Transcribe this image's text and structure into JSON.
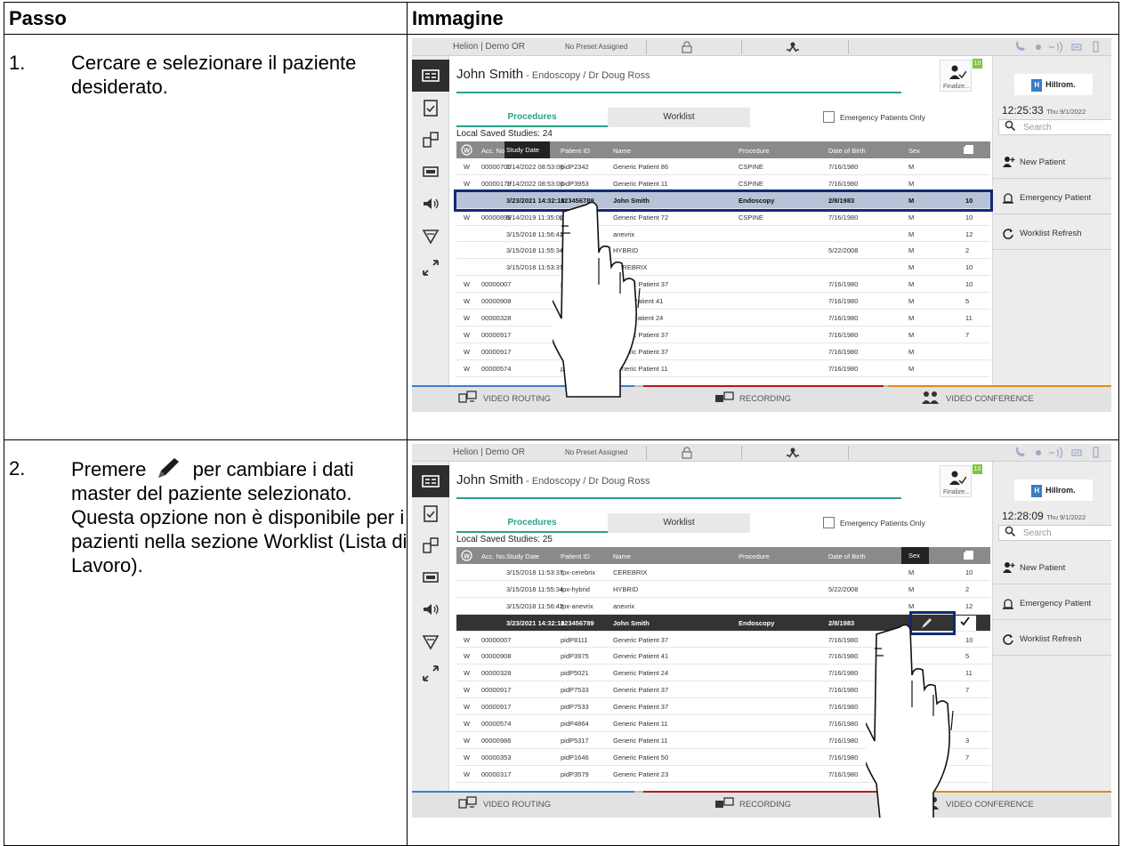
{
  "table": {
    "col_step": "Passo",
    "col_image": "Immagine"
  },
  "steps": [
    {
      "num": "1.",
      "text_before": "Cercare e selezionare il paziente desiderato.",
      "pencil": false,
      "text_after": ""
    },
    {
      "num": "2.",
      "text_before": "Premere",
      "pencil": true,
      "text_after": "per cambiare i dati master del paziente selezionato. Questa opzione non è disponibile per i pazienti nella sezione Worklist (Lista di Lavoro)."
    }
  ],
  "screens": [
    {
      "topbar": {
        "room": "Helion | Demo OR",
        "preset": "No Preset Assigned"
      },
      "patient": {
        "name": "John Smith",
        "detail": " - Endoscopy / Dr Doug Ross"
      },
      "finalize": "Finalize...",
      "finalize_badge": "10",
      "tabs": {
        "procedures": "Procedures",
        "worklist": "Worklist"
      },
      "emergency_only": "Emergency Patients Only",
      "local_saved": "Local Saved Studies: 24",
      "logo": "Hillrom.",
      "clock": {
        "time": "12:25:33",
        "date": "Thu 9/1/2022"
      },
      "search_placeholder": "Search",
      "buttons": [
        "New Patient",
        "Emergency Patient",
        "Worklist Refresh"
      ],
      "columns": [
        "Acc. No.",
        "Study Date",
        "Patient ID",
        "Name",
        "Procedure",
        "Date of Birth",
        "Sex"
      ],
      "rows": [
        {
          "w": "W",
          "acc": "00000706",
          "date": "1/14/2022 08:53:00",
          "pid": "pidP2342",
          "name": "Generic Patient 86",
          "proc": "CSPINE",
          "dob": "7/16/1980",
          "sex": "M",
          "n": "",
          "style": ""
        },
        {
          "w": "W",
          "acc": "00000178",
          "date": "1/14/2022 08:53:00",
          "pid": "pidP3953",
          "name": "Generic Patient 11",
          "proc": "CSPINE",
          "dob": "7/16/1980",
          "sex": "M",
          "n": "",
          "style": ""
        },
        {
          "w": "",
          "acc": "",
          "date": "3/23/2021 14:32:10",
          "pid": "123456789",
          "name": "John Smith",
          "proc": "Endoscopy",
          "dob": "2/8/1983",
          "sex": "M",
          "n": "10",
          "style": "hl"
        },
        {
          "w": "W",
          "acc": "00000896",
          "date": "5/14/2019 11:35:00",
          "pid": "pidP6920",
          "name": "Generic Patient 72",
          "proc": "CSPINE",
          "dob": "7/16/1980",
          "sex": "M",
          "n": "10",
          "style": ""
        },
        {
          "w": "",
          "acc": "",
          "date": "3/15/2018 11:56:42",
          "pid": "tpx-anevrix",
          "name": "anevrix",
          "proc": "",
          "dob": "",
          "sex": "M",
          "n": "12",
          "style": ""
        },
        {
          "w": "",
          "acc": "",
          "date": "3/15/2018 11:55:34",
          "pid": "tpx-hybrid",
          "name": "HYBRID",
          "proc": "",
          "dob": "5/22/2008",
          "sex": "M",
          "n": "2",
          "style": ""
        },
        {
          "w": "",
          "acc": "",
          "date": "3/15/2018 11:53:37",
          "pid": "tpx-ce",
          "name": "CEREBRIX",
          "proc": "",
          "dob": "",
          "sex": "M",
          "n": "10",
          "style": ""
        },
        {
          "w": "W",
          "acc": "00000007",
          "date": "",
          "pid": "p",
          "name": "Generic Patient 37",
          "proc": "",
          "dob": "7/16/1980",
          "sex": "M",
          "n": "10",
          "style": ""
        },
        {
          "w": "W",
          "acc": "00000908",
          "date": "",
          "pid": "",
          "name": "eneric Patient 41",
          "proc": "",
          "dob": "7/16/1980",
          "sex": "M",
          "n": "5",
          "style": ""
        },
        {
          "w": "W",
          "acc": "00000328",
          "date": "",
          "pid": "",
          "name": "eneric Patient 24",
          "proc": "",
          "dob": "7/16/1980",
          "sex": "M",
          "n": "11",
          "style": ""
        },
        {
          "w": "W",
          "acc": "00000917",
          "date": "",
          "pid": "p",
          "name": "Generic Patient 37",
          "proc": "",
          "dob": "7/16/1980",
          "sex": "M",
          "n": "7",
          "style": ""
        },
        {
          "w": "W",
          "acc": "00000917",
          "date": "",
          "pid": "pid",
          "name": "Generic Patient 37",
          "proc": "",
          "dob": "7/16/1980",
          "sex": "M",
          "n": "",
          "style": ""
        },
        {
          "w": "W",
          "acc": "00000574",
          "date": "",
          "pid": "pidl",
          "name": "Generic Patient 11",
          "proc": "",
          "dob": "7/16/1980",
          "sex": "M",
          "n": "",
          "style": ""
        }
      ],
      "bottom": [
        "VIDEO ROUTING",
        "RECORDING",
        "VIDEO CONFERENCE"
      ],
      "highlight_row": 2,
      "hand_mode": "row"
    },
    {
      "topbar": {
        "room": "Helion | Demo OR",
        "preset": "No Preset Assigned"
      },
      "patient": {
        "name": "John Smith",
        "detail": " - Endoscopy / Dr Doug Ross"
      },
      "finalize": "Finalize...",
      "finalize_badge": "10",
      "tabs": {
        "procedures": "Procedures",
        "worklist": "Worklist"
      },
      "emergency_only": "Emergency Patients Only",
      "local_saved": "Local Saved Studies: 25",
      "logo": "Hillrom.",
      "clock": {
        "time": "12:28:09",
        "date": "Thu 9/1/2022"
      },
      "search_placeholder": "Search",
      "buttons": [
        "New Patient",
        "Emergency Patient",
        "Worklist Refresh"
      ],
      "columns": [
        "Acc. No.",
        "Study Date",
        "Patient ID",
        "Name",
        "Procedure",
        "Date of Birth",
        "Sex"
      ],
      "rows": [
        {
          "w": "",
          "acc": "",
          "date": "3/15/2018 11:53:37",
          "pid": "tpx-cerebrix",
          "name": "CEREBRIX",
          "proc": "",
          "dob": "",
          "sex": "M",
          "n": "10",
          "style": ""
        },
        {
          "w": "",
          "acc": "",
          "date": "3/15/2018 11:55:34",
          "pid": "tpx-hybrid",
          "name": "HYBRID",
          "proc": "",
          "dob": "5/22/2008",
          "sex": "M",
          "n": "2",
          "style": ""
        },
        {
          "w": "",
          "acc": "",
          "date": "3/15/2018 11:56:42",
          "pid": "tpx-anevrix",
          "name": "anevrix",
          "proc": "",
          "dob": "",
          "sex": "M",
          "n": "12",
          "style": ""
        },
        {
          "w": "",
          "acc": "",
          "date": "3/23/2021 14:32:10",
          "pid": "123456789",
          "name": "John Smith",
          "proc": "Endoscopy",
          "dob": "2/8/1983",
          "sex": "",
          "n": "",
          "style": "dark"
        },
        {
          "w": "W",
          "acc": "00000007",
          "date": "",
          "pid": "pidP8111",
          "name": "Generic Patient 37",
          "proc": "",
          "dob": "7/16/1980",
          "sex": "",
          "n": "10",
          "style": ""
        },
        {
          "w": "W",
          "acc": "00000908",
          "date": "",
          "pid": "pidP3975",
          "name": "Generic Patient 41",
          "proc": "",
          "dob": "7/16/1980",
          "sex": "",
          "n": "5",
          "style": ""
        },
        {
          "w": "W",
          "acc": "00000328",
          "date": "",
          "pid": "pidP5021",
          "name": "Generic Patient 24",
          "proc": "",
          "dob": "7/16/1980",
          "sex": "",
          "n": "11",
          "style": ""
        },
        {
          "w": "W",
          "acc": "00000917",
          "date": "",
          "pid": "pidP7533",
          "name": "Generic Patient 37",
          "proc": "",
          "dob": "7/16/1980",
          "sex": "",
          "n": "7",
          "style": ""
        },
        {
          "w": "W",
          "acc": "00000917",
          "date": "",
          "pid": "pidP7533",
          "name": "Generic Patient 37",
          "proc": "",
          "dob": "7/16/1980",
          "sex": "",
          "n": "",
          "style": ""
        },
        {
          "w": "W",
          "acc": "00000574",
          "date": "",
          "pid": "pidP4864",
          "name": "Generic Patient 11",
          "proc": "",
          "dob": "7/16/1980",
          "sex": "",
          "n": "",
          "style": ""
        },
        {
          "w": "W",
          "acc": "00000986",
          "date": "",
          "pid": "pidP5317",
          "name": "Generic Patient 11",
          "proc": "",
          "dob": "7/16/1980",
          "sex": "",
          "n": "3",
          "style": ""
        },
        {
          "w": "W",
          "acc": "00000353",
          "date": "",
          "pid": "pidP1646",
          "name": "Generic Patient 50",
          "proc": "",
          "dob": "7/16/1980",
          "sex": "",
          "n": "7",
          "style": ""
        },
        {
          "w": "W",
          "acc": "00000317",
          "date": "",
          "pid": "pidP3579",
          "name": "Generic Patient 23",
          "proc": "",
          "dob": "7/16/1980",
          "sex": "",
          "n": "",
          "style": ""
        }
      ],
      "bottom": [
        "VIDEO ROUTING",
        "RECORDING",
        "VIDEO CONFERENCE"
      ],
      "highlight_row": 3,
      "hand_mode": "edit"
    }
  ],
  "colors": {
    "accent": "#2aa08a",
    "highlight_frame": "#0e2a78",
    "row_highlight": "#b8c3d7",
    "hillrom_blue": "#3b7bc9"
  }
}
